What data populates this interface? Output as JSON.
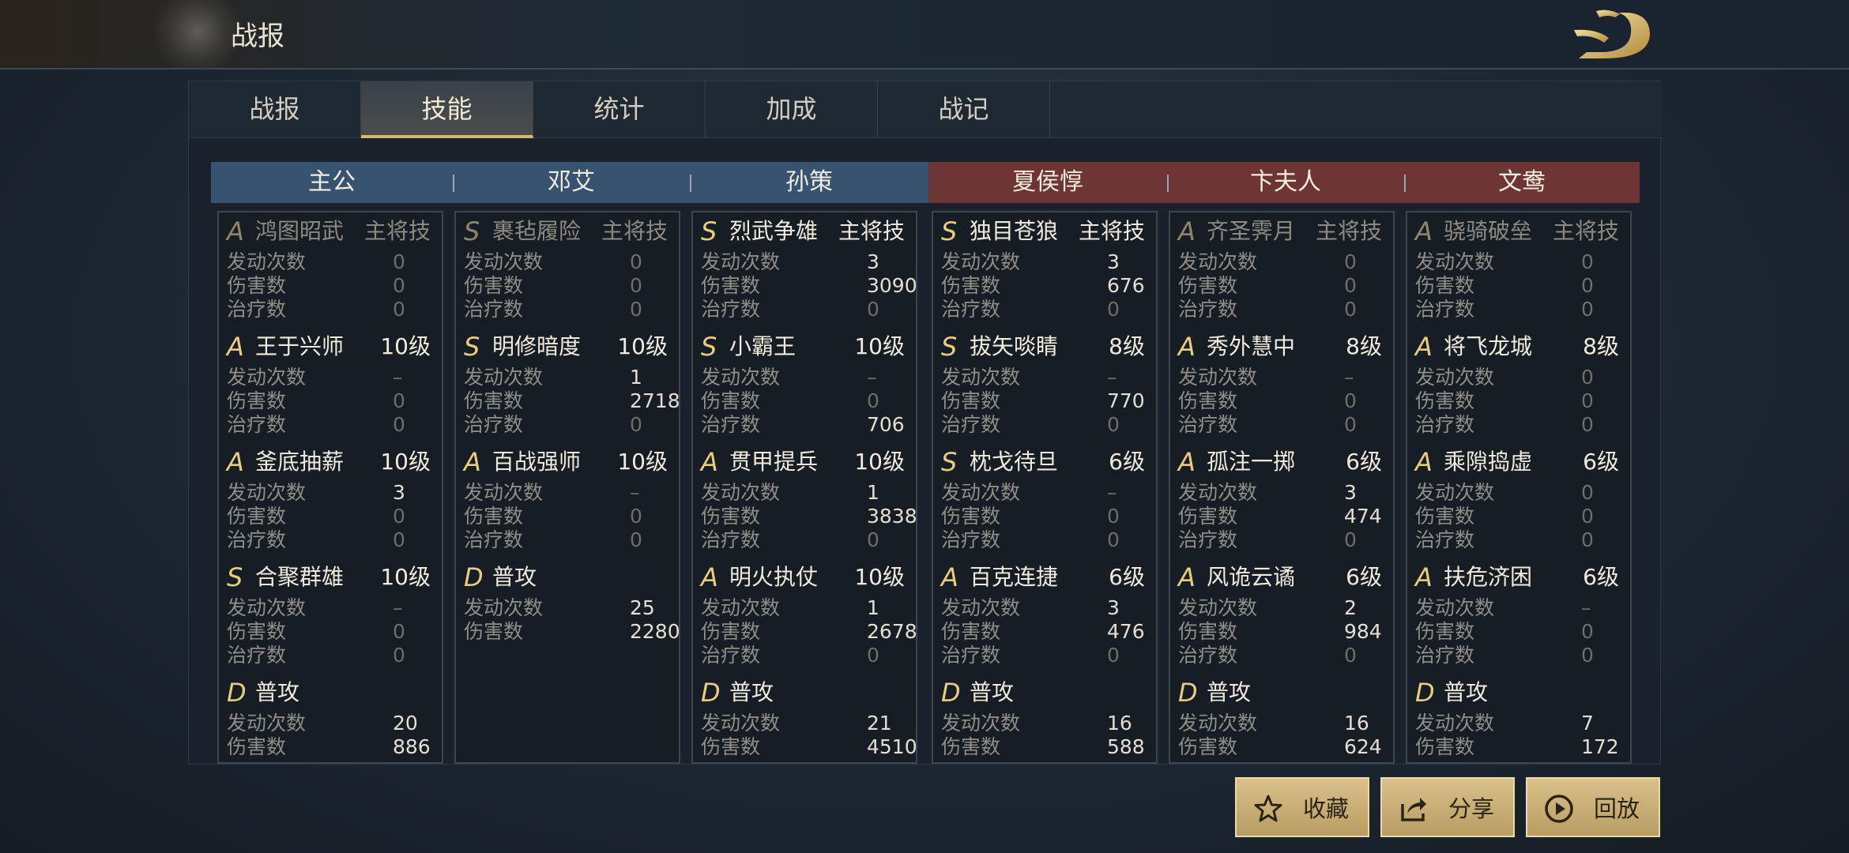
{
  "window": {
    "title": "战报"
  },
  "tabs": [
    {
      "label": "战报",
      "active": false
    },
    {
      "label": "技能",
      "active": true
    },
    {
      "label": "统计",
      "active": false
    },
    {
      "label": "加成",
      "active": false
    },
    {
      "label": "战记",
      "active": false
    }
  ],
  "stat_labels": {
    "activations": "发动次数",
    "damage": "伤害数",
    "heal": "治疗数"
  },
  "heroes": [
    {
      "name": "主公",
      "side": "blue",
      "skills": [
        {
          "grade": "A",
          "name": "鸿图昭武",
          "level": "主将技",
          "dim": true,
          "stats": {
            "activations": "0",
            "damage": "0",
            "heal": "0"
          }
        },
        {
          "grade": "A",
          "name": "王于兴师",
          "level": "10级",
          "stats": {
            "activations": "–",
            "damage": "0",
            "heal": "0"
          }
        },
        {
          "grade": "A",
          "name": "釜底抽薪",
          "level": "10级",
          "stats": {
            "activations": "3",
            "damage": "0",
            "heal": "0"
          }
        },
        {
          "grade": "S",
          "name": "合聚群雄",
          "level": "10级",
          "stats": {
            "activations": "–",
            "damage": "0",
            "heal": "0"
          }
        },
        {
          "grade": "D",
          "name": "普攻",
          "level": "",
          "stats": {
            "activations": "20",
            "damage": "886"
          }
        }
      ]
    },
    {
      "name": "邓艾",
      "side": "blue",
      "skills": [
        {
          "grade": "S",
          "name": "裹毡履险",
          "level": "主将技",
          "dim": true,
          "stats": {
            "activations": "0",
            "damage": "0",
            "heal": "0"
          }
        },
        {
          "grade": "S",
          "name": "明修暗度",
          "level": "10级",
          "stats": {
            "activations": "1",
            "damage": "2718",
            "heal": "0"
          }
        },
        {
          "grade": "A",
          "name": "百战强师",
          "level": "10级",
          "stats": {
            "activations": "–",
            "damage": "0",
            "heal": "0"
          }
        },
        {
          "grade": "D",
          "name": "普攻",
          "level": "",
          "stats": {
            "activations": "25",
            "damage": "2280"
          }
        }
      ]
    },
    {
      "name": "孙策",
      "side": "blue",
      "skills": [
        {
          "grade": "S",
          "name": "烈武争雄",
          "level": "主将技",
          "stats": {
            "activations": "3",
            "damage": "3090",
            "heal": "0"
          }
        },
        {
          "grade": "S",
          "name": "小霸王",
          "level": "10级",
          "stats": {
            "activations": "–",
            "damage": "0",
            "heal": "706"
          }
        },
        {
          "grade": "A",
          "name": "贯甲提兵",
          "level": "10级",
          "stats": {
            "activations": "1",
            "damage": "3838",
            "heal": "0"
          }
        },
        {
          "grade": "A",
          "name": "明火执仗",
          "level": "10级",
          "stats": {
            "activations": "1",
            "damage": "2678",
            "heal": "0"
          }
        },
        {
          "grade": "D",
          "name": "普攻",
          "level": "",
          "stats": {
            "activations": "21",
            "damage": "4510"
          }
        }
      ]
    },
    {
      "name": "夏侯惇",
      "side": "red",
      "skills": [
        {
          "grade": "S",
          "name": "独目苍狼",
          "level": "主将技",
          "stats": {
            "activations": "3",
            "damage": "676",
            "heal": "0"
          }
        },
        {
          "grade": "S",
          "name": "拔矢啖睛",
          "level": "8级",
          "stats": {
            "activations": "–",
            "damage": "770",
            "heal": "0"
          }
        },
        {
          "grade": "S",
          "name": "枕戈待旦",
          "level": "6级",
          "stats": {
            "activations": "–",
            "damage": "0",
            "heal": "0"
          }
        },
        {
          "grade": "A",
          "name": "百克连捷",
          "level": "6级",
          "stats": {
            "activations": "3",
            "damage": "476",
            "heal": "0"
          }
        },
        {
          "grade": "D",
          "name": "普攻",
          "level": "",
          "stats": {
            "activations": "16",
            "damage": "588"
          }
        }
      ]
    },
    {
      "name": "卞夫人",
      "side": "red",
      "skills": [
        {
          "grade": "A",
          "name": "齐圣霁月",
          "level": "主将技",
          "dim": true,
          "stats": {
            "activations": "0",
            "damage": "0",
            "heal": "0"
          }
        },
        {
          "grade": "A",
          "name": "秀外慧中",
          "level": "8级",
          "stats": {
            "activations": "–",
            "damage": "0",
            "heal": "0"
          }
        },
        {
          "grade": "A",
          "name": "孤注一掷",
          "level": "6级",
          "stats": {
            "activations": "3",
            "damage": "474",
            "heal": "0"
          }
        },
        {
          "grade": "A",
          "name": "风诡云谲",
          "level": "6级",
          "stats": {
            "activations": "2",
            "damage": "984",
            "heal": "0"
          }
        },
        {
          "grade": "D",
          "name": "普攻",
          "level": "",
          "stats": {
            "activations": "16",
            "damage": "624"
          }
        }
      ]
    },
    {
      "name": "文鸯",
      "side": "red",
      "skills": [
        {
          "grade": "A",
          "name": "骁骑破垒",
          "level": "主将技",
          "dim": true,
          "stats": {
            "activations": "0",
            "damage": "0",
            "heal": "0"
          }
        },
        {
          "grade": "A",
          "name": "将飞龙城",
          "level": "8级",
          "stats": {
            "activations": "0",
            "damage": "0",
            "heal": "0"
          }
        },
        {
          "grade": "A",
          "name": "乘隙捣虚",
          "level": "6级",
          "stats": {
            "activations": "0",
            "damage": "0",
            "heal": "0"
          }
        },
        {
          "grade": "A",
          "name": "扶危济困",
          "level": "6级",
          "stats": {
            "activations": "–",
            "damage": "0",
            "heal": "0"
          }
        },
        {
          "grade": "D",
          "name": "普攻",
          "level": "",
          "stats": {
            "activations": "7",
            "damage": "172"
          }
        }
      ]
    }
  ],
  "buttons": [
    {
      "label": "收藏",
      "icon": "star-icon"
    },
    {
      "label": "分享",
      "icon": "share-icon"
    },
    {
      "label": "回放",
      "icon": "play-icon"
    }
  ],
  "colors": {
    "ally_header": "#38536f",
    "enemy_header": "#6e3535",
    "gold_accent": "#d9b865",
    "grade_text": "#e9cc7e"
  }
}
